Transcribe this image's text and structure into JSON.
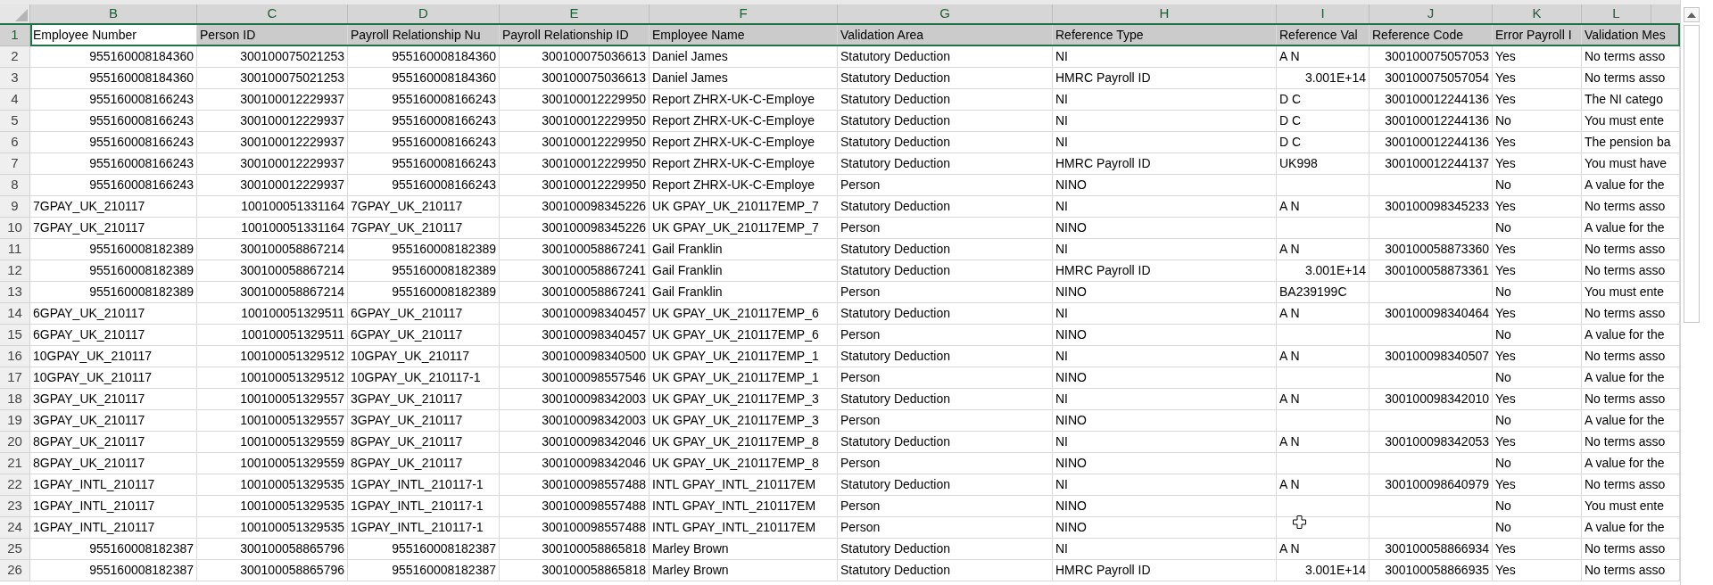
{
  "columns": [
    {
      "letter": "B"
    },
    {
      "letter": "C"
    },
    {
      "letter": "D"
    },
    {
      "letter": "E"
    },
    {
      "letter": "F"
    },
    {
      "letter": "G"
    },
    {
      "letter": "H"
    },
    {
      "letter": "I"
    },
    {
      "letter": "J"
    },
    {
      "letter": "K"
    },
    {
      "letter": "L"
    }
  ],
  "rows": [
    {
      "number": "1",
      "selected": true,
      "cells": [
        {
          "kind": "text",
          "text": "Employee Number",
          "active": true
        },
        {
          "kind": "text",
          "text": "Person ID",
          "active": false
        },
        {
          "kind": "text",
          "text": "Payroll Relationship Nu",
          "active": false
        },
        {
          "kind": "text",
          "text": "Payroll Relationship ID",
          "active": false
        },
        {
          "kind": "text",
          "text": "Employee Name",
          "active": false
        },
        {
          "kind": "text",
          "text": "Validation Area",
          "active": false
        },
        {
          "kind": "text",
          "text": "Reference Type",
          "active": false
        },
        {
          "kind": "text",
          "text": "Reference Val",
          "active": false
        },
        {
          "kind": "text",
          "text": "Reference Code",
          "active": false
        },
        {
          "kind": "text",
          "text": "Error Payroll I",
          "active": false
        },
        {
          "kind": "text",
          "text": "Validation Mes",
          "active": false
        }
      ]
    },
    {
      "number": "2",
      "selected": false,
      "cells": [
        {
          "kind": "number",
          "text": "955160008184360"
        },
        {
          "kind": "number",
          "text": "300100075021253"
        },
        {
          "kind": "number",
          "text": "955160008184360"
        },
        {
          "kind": "number",
          "text": "300100075036613"
        },
        {
          "kind": "text",
          "text": "Daniel James"
        },
        {
          "kind": "text",
          "text": "Statutory Deduction"
        },
        {
          "kind": "text",
          "text": "NI"
        },
        {
          "kind": "text",
          "text": "A N"
        },
        {
          "kind": "number",
          "text": "300100075057053"
        },
        {
          "kind": "text",
          "text": "Yes"
        },
        {
          "kind": "text",
          "text": "No terms asso"
        }
      ]
    },
    {
      "number": "3",
      "selected": false,
      "cells": [
        {
          "kind": "number",
          "text": "955160008184360"
        },
        {
          "kind": "number",
          "text": "300100075021253"
        },
        {
          "kind": "number",
          "text": "955160008184360"
        },
        {
          "kind": "number",
          "text": "300100075036613"
        },
        {
          "kind": "text",
          "text": "Daniel James"
        },
        {
          "kind": "text",
          "text": "Statutory Deduction"
        },
        {
          "kind": "text",
          "text": "HMRC Payroll ID"
        },
        {
          "kind": "number",
          "text": "3.001E+14"
        },
        {
          "kind": "number",
          "text": "300100075057054"
        },
        {
          "kind": "text",
          "text": "Yes"
        },
        {
          "kind": "text",
          "text": "No terms asso"
        }
      ]
    },
    {
      "number": "4",
      "selected": false,
      "cells": [
        {
          "kind": "number",
          "text": "955160008166243"
        },
        {
          "kind": "number",
          "text": "300100012229937"
        },
        {
          "kind": "number",
          "text": "955160008166243"
        },
        {
          "kind": "number",
          "text": "300100012229950"
        },
        {
          "kind": "text",
          "text": "Report ZHRX-UK-C-Employe"
        },
        {
          "kind": "text",
          "text": "Statutory Deduction"
        },
        {
          "kind": "text",
          "text": "NI"
        },
        {
          "kind": "text",
          "text": "D C"
        },
        {
          "kind": "number",
          "text": "300100012244136"
        },
        {
          "kind": "text",
          "text": "Yes"
        },
        {
          "kind": "text",
          "text": "The NI catego"
        }
      ]
    },
    {
      "number": "5",
      "selected": false,
      "cells": [
        {
          "kind": "number",
          "text": "955160008166243"
        },
        {
          "kind": "number",
          "text": "300100012229937"
        },
        {
          "kind": "number",
          "text": "955160008166243"
        },
        {
          "kind": "number",
          "text": "300100012229950"
        },
        {
          "kind": "text",
          "text": "Report ZHRX-UK-C-Employe"
        },
        {
          "kind": "text",
          "text": "Statutory Deduction"
        },
        {
          "kind": "text",
          "text": "NI"
        },
        {
          "kind": "text",
          "text": "D C"
        },
        {
          "kind": "number",
          "text": "300100012244136"
        },
        {
          "kind": "text",
          "text": "No"
        },
        {
          "kind": "text",
          "text": "You must ente"
        }
      ]
    },
    {
      "number": "6",
      "selected": false,
      "cells": [
        {
          "kind": "number",
          "text": "955160008166243"
        },
        {
          "kind": "number",
          "text": "300100012229937"
        },
        {
          "kind": "number",
          "text": "955160008166243"
        },
        {
          "kind": "number",
          "text": "300100012229950"
        },
        {
          "kind": "text",
          "text": "Report ZHRX-UK-C-Employe"
        },
        {
          "kind": "text",
          "text": "Statutory Deduction"
        },
        {
          "kind": "text",
          "text": "NI"
        },
        {
          "kind": "text",
          "text": "D C"
        },
        {
          "kind": "number",
          "text": "300100012244136"
        },
        {
          "kind": "text",
          "text": "Yes"
        },
        {
          "kind": "text",
          "text": "The pension ba"
        }
      ]
    },
    {
      "number": "7",
      "selected": false,
      "cells": [
        {
          "kind": "number",
          "text": "955160008166243"
        },
        {
          "kind": "number",
          "text": "300100012229937"
        },
        {
          "kind": "number",
          "text": "955160008166243"
        },
        {
          "kind": "number",
          "text": "300100012229950"
        },
        {
          "kind": "text",
          "text": "Report ZHRX-UK-C-Employe"
        },
        {
          "kind": "text",
          "text": "Statutory Deduction"
        },
        {
          "kind": "text",
          "text": "HMRC Payroll ID"
        },
        {
          "kind": "text",
          "text": "UK998"
        },
        {
          "kind": "number",
          "text": "300100012244137"
        },
        {
          "kind": "text",
          "text": "Yes"
        },
        {
          "kind": "text",
          "text": "You must have"
        }
      ]
    },
    {
      "number": "8",
      "selected": false,
      "cells": [
        {
          "kind": "number",
          "text": "955160008166243"
        },
        {
          "kind": "number",
          "text": "300100012229937"
        },
        {
          "kind": "number",
          "text": "955160008166243"
        },
        {
          "kind": "number",
          "text": "300100012229950"
        },
        {
          "kind": "text",
          "text": "Report ZHRX-UK-C-Employe"
        },
        {
          "kind": "text",
          "text": "Person"
        },
        {
          "kind": "text",
          "text": "NINO"
        },
        null,
        null,
        {
          "kind": "text",
          "text": "No"
        },
        {
          "kind": "text",
          "text": "A value for the"
        }
      ]
    },
    {
      "number": "9",
      "selected": false,
      "cells": [
        {
          "kind": "text",
          "text": "7GPAY_UK_210117"
        },
        {
          "kind": "number",
          "text": "100100051331164"
        },
        {
          "kind": "text",
          "text": "7GPAY_UK_210117"
        },
        {
          "kind": "number",
          "text": "300100098345226"
        },
        {
          "kind": "text",
          "text": "UK GPAY_UK_210117EMP_7"
        },
        {
          "kind": "text",
          "text": "Statutory Deduction"
        },
        {
          "kind": "text",
          "text": "NI"
        },
        {
          "kind": "text",
          "text": "A N"
        },
        {
          "kind": "number",
          "text": "300100098345233"
        },
        {
          "kind": "text",
          "text": "Yes"
        },
        {
          "kind": "text",
          "text": "No terms asso"
        }
      ]
    },
    {
      "number": "10",
      "selected": false,
      "cells": [
        {
          "kind": "text",
          "text": "7GPAY_UK_210117"
        },
        {
          "kind": "number",
          "text": "100100051331164"
        },
        {
          "kind": "text",
          "text": "7GPAY_UK_210117"
        },
        {
          "kind": "number",
          "text": "300100098345226"
        },
        {
          "kind": "text",
          "text": "UK GPAY_UK_210117EMP_7"
        },
        {
          "kind": "text",
          "text": "Person"
        },
        {
          "kind": "text",
          "text": "NINO"
        },
        null,
        null,
        {
          "kind": "text",
          "text": "No"
        },
        {
          "kind": "text",
          "text": "A value for the"
        }
      ]
    },
    {
      "number": "11",
      "selected": false,
      "cells": [
        {
          "kind": "number",
          "text": "955160008182389"
        },
        {
          "kind": "number",
          "text": "300100058867214"
        },
        {
          "kind": "number",
          "text": "955160008182389"
        },
        {
          "kind": "number",
          "text": "300100058867241"
        },
        {
          "kind": "text",
          "text": "Gail Franklin"
        },
        {
          "kind": "text",
          "text": "Statutory Deduction"
        },
        {
          "kind": "text",
          "text": "NI"
        },
        {
          "kind": "text",
          "text": "A N"
        },
        {
          "kind": "number",
          "text": "300100058873360"
        },
        {
          "kind": "text",
          "text": "Yes"
        },
        {
          "kind": "text",
          "text": "No terms asso"
        }
      ]
    },
    {
      "number": "12",
      "selected": false,
      "cells": [
        {
          "kind": "number",
          "text": "955160008182389"
        },
        {
          "kind": "number",
          "text": "300100058867214"
        },
        {
          "kind": "number",
          "text": "955160008182389"
        },
        {
          "kind": "number",
          "text": "300100058867241"
        },
        {
          "kind": "text",
          "text": "Gail Franklin"
        },
        {
          "kind": "text",
          "text": "Statutory Deduction"
        },
        {
          "kind": "text",
          "text": "HMRC Payroll ID"
        },
        {
          "kind": "number",
          "text": "3.001E+14"
        },
        {
          "kind": "number",
          "text": "300100058873361"
        },
        {
          "kind": "text",
          "text": "Yes"
        },
        {
          "kind": "text",
          "text": "No terms asso"
        }
      ]
    },
    {
      "number": "13",
      "selected": false,
      "cells": [
        {
          "kind": "number",
          "text": "955160008182389"
        },
        {
          "kind": "number",
          "text": "300100058867214"
        },
        {
          "kind": "number",
          "text": "955160008182389"
        },
        {
          "kind": "number",
          "text": "300100058867241"
        },
        {
          "kind": "text",
          "text": "Gail Franklin"
        },
        {
          "kind": "text",
          "text": "Person"
        },
        {
          "kind": "text",
          "text": "NINO"
        },
        {
          "kind": "text",
          "text": "BA239199C"
        },
        null,
        {
          "kind": "text",
          "text": "No"
        },
        {
          "kind": "text",
          "text": "You must ente"
        }
      ]
    },
    {
      "number": "14",
      "selected": false,
      "cells": [
        {
          "kind": "text",
          "text": "6GPAY_UK_210117"
        },
        {
          "kind": "number",
          "text": "100100051329511"
        },
        {
          "kind": "text",
          "text": "6GPAY_UK_210117"
        },
        {
          "kind": "number",
          "text": "300100098340457"
        },
        {
          "kind": "text",
          "text": "UK GPAY_UK_210117EMP_6"
        },
        {
          "kind": "text",
          "text": "Statutory Deduction"
        },
        {
          "kind": "text",
          "text": "NI"
        },
        {
          "kind": "text",
          "text": "A N"
        },
        {
          "kind": "number",
          "text": "300100098340464"
        },
        {
          "kind": "text",
          "text": "Yes"
        },
        {
          "kind": "text",
          "text": "No terms asso"
        }
      ]
    },
    {
      "number": "15",
      "selected": false,
      "cells": [
        {
          "kind": "text",
          "text": "6GPAY_UK_210117"
        },
        {
          "kind": "number",
          "text": "100100051329511"
        },
        {
          "kind": "text",
          "text": "6GPAY_UK_210117"
        },
        {
          "kind": "number",
          "text": "300100098340457"
        },
        {
          "kind": "text",
          "text": "UK GPAY_UK_210117EMP_6"
        },
        {
          "kind": "text",
          "text": "Person"
        },
        {
          "kind": "text",
          "text": "NINO"
        },
        null,
        null,
        {
          "kind": "text",
          "text": "No"
        },
        {
          "kind": "text",
          "text": "A value for the"
        }
      ]
    },
    {
      "number": "16",
      "selected": false,
      "cells": [
        {
          "kind": "text",
          "text": "10GPAY_UK_210117"
        },
        {
          "kind": "number",
          "text": "100100051329512"
        },
        {
          "kind": "text",
          "text": "10GPAY_UK_210117"
        },
        {
          "kind": "number",
          "text": "300100098340500"
        },
        {
          "kind": "text",
          "text": "UK GPAY_UK_210117EMP_1"
        },
        {
          "kind": "text",
          "text": "Statutory Deduction"
        },
        {
          "kind": "text",
          "text": "NI"
        },
        {
          "kind": "text",
          "text": "A N"
        },
        {
          "kind": "number",
          "text": "300100098340507"
        },
        {
          "kind": "text",
          "text": "Yes"
        },
        {
          "kind": "text",
          "text": "No terms asso"
        }
      ]
    },
    {
      "number": "17",
      "selected": false,
      "cells": [
        {
          "kind": "text",
          "text": "10GPAY_UK_210117"
        },
        {
          "kind": "number",
          "text": "100100051329512"
        },
        {
          "kind": "text",
          "text": "10GPAY_UK_210117-1"
        },
        {
          "kind": "number",
          "text": "300100098557546"
        },
        {
          "kind": "text",
          "text": "UK GPAY_UK_210117EMP_1"
        },
        {
          "kind": "text",
          "text": "Person"
        },
        {
          "kind": "text",
          "text": "NINO"
        },
        null,
        null,
        {
          "kind": "text",
          "text": "No"
        },
        {
          "kind": "text",
          "text": "A value for the"
        }
      ]
    },
    {
      "number": "18",
      "selected": false,
      "cells": [
        {
          "kind": "text",
          "text": "3GPAY_UK_210117"
        },
        {
          "kind": "number",
          "text": "100100051329557"
        },
        {
          "kind": "text",
          "text": "3GPAY_UK_210117"
        },
        {
          "kind": "number",
          "text": "300100098342003"
        },
        {
          "kind": "text",
          "text": "UK GPAY_UK_210117EMP_3"
        },
        {
          "kind": "text",
          "text": "Statutory Deduction"
        },
        {
          "kind": "text",
          "text": "NI"
        },
        {
          "kind": "text",
          "text": "A N"
        },
        {
          "kind": "number",
          "text": "300100098342010"
        },
        {
          "kind": "text",
          "text": "Yes"
        },
        {
          "kind": "text",
          "text": "No terms asso"
        }
      ]
    },
    {
      "number": "19",
      "selected": false,
      "cells": [
        {
          "kind": "text",
          "text": "3GPAY_UK_210117"
        },
        {
          "kind": "number",
          "text": "100100051329557"
        },
        {
          "kind": "text",
          "text": "3GPAY_UK_210117"
        },
        {
          "kind": "number",
          "text": "300100098342003"
        },
        {
          "kind": "text",
          "text": "UK GPAY_UK_210117EMP_3"
        },
        {
          "kind": "text",
          "text": "Person"
        },
        {
          "kind": "text",
          "text": "NINO"
        },
        null,
        null,
        {
          "kind": "text",
          "text": "No"
        },
        {
          "kind": "text",
          "text": "A value for the"
        }
      ]
    },
    {
      "number": "20",
      "selected": false,
      "cells": [
        {
          "kind": "text",
          "text": "8GPAY_UK_210117"
        },
        {
          "kind": "number",
          "text": "100100051329559"
        },
        {
          "kind": "text",
          "text": "8GPAY_UK_210117"
        },
        {
          "kind": "number",
          "text": "300100098342046"
        },
        {
          "kind": "text",
          "text": "UK GPAY_UK_210117EMP_8"
        },
        {
          "kind": "text",
          "text": "Statutory Deduction"
        },
        {
          "kind": "text",
          "text": "NI"
        },
        {
          "kind": "text",
          "text": "A N"
        },
        {
          "kind": "number",
          "text": "300100098342053"
        },
        {
          "kind": "text",
          "text": "Yes"
        },
        {
          "kind": "text",
          "text": "No terms asso"
        }
      ]
    },
    {
      "number": "21",
      "selected": false,
      "cells": [
        {
          "kind": "text",
          "text": "8GPAY_UK_210117"
        },
        {
          "kind": "number",
          "text": "100100051329559"
        },
        {
          "kind": "text",
          "text": "8GPAY_UK_210117"
        },
        {
          "kind": "number",
          "text": "300100098342046"
        },
        {
          "kind": "text",
          "text": "UK GPAY_UK_210117EMP_8"
        },
        {
          "kind": "text",
          "text": "Person"
        },
        {
          "kind": "text",
          "text": "NINO"
        },
        null,
        null,
        {
          "kind": "text",
          "text": "No"
        },
        {
          "kind": "text",
          "text": "A value for the"
        }
      ]
    },
    {
      "number": "22",
      "selected": false,
      "cells": [
        {
          "kind": "text",
          "text": "1GPAY_INTL_210117"
        },
        {
          "kind": "number",
          "text": "100100051329535"
        },
        {
          "kind": "text",
          "text": "1GPAY_INTL_210117-1"
        },
        {
          "kind": "number",
          "text": "300100098557488"
        },
        {
          "kind": "text",
          "text": "INTL GPAY_INTL_210117EM"
        },
        {
          "kind": "text",
          "text": "Statutory Deduction"
        },
        {
          "kind": "text",
          "text": "NI"
        },
        {
          "kind": "text",
          "text": "A N"
        },
        {
          "kind": "number",
          "text": "300100098640979"
        },
        {
          "kind": "text",
          "text": "Yes"
        },
        {
          "kind": "text",
          "text": "No terms asso"
        }
      ]
    },
    {
      "number": "23",
      "selected": false,
      "cells": [
        {
          "kind": "text",
          "text": "1GPAY_INTL_210117"
        },
        {
          "kind": "number",
          "text": "100100051329535"
        },
        {
          "kind": "text",
          "text": "1GPAY_INTL_210117-1"
        },
        {
          "kind": "number",
          "text": "300100098557488"
        },
        {
          "kind": "text",
          "text": "INTL GPAY_INTL_210117EM"
        },
        {
          "kind": "text",
          "text": "Person"
        },
        {
          "kind": "text",
          "text": "NINO"
        },
        null,
        null,
        {
          "kind": "text",
          "text": "No"
        },
        {
          "kind": "text",
          "text": "You must ente"
        }
      ]
    },
    {
      "number": "24",
      "selected": false,
      "cells": [
        {
          "kind": "text",
          "text": "1GPAY_INTL_210117"
        },
        {
          "kind": "number",
          "text": "100100051329535"
        },
        {
          "kind": "text",
          "text": "1GPAY_INTL_210117-1"
        },
        {
          "kind": "number",
          "text": "300100098557488"
        },
        {
          "kind": "text",
          "text": "INTL GPAY_INTL_210117EM"
        },
        {
          "kind": "text",
          "text": "Person"
        },
        {
          "kind": "text",
          "text": "NINO"
        },
        null,
        null,
        {
          "kind": "text",
          "text": "No"
        },
        {
          "kind": "text",
          "text": "A value for the"
        }
      ]
    },
    {
      "number": "25",
      "selected": false,
      "cells": [
        {
          "kind": "number",
          "text": "955160008182387"
        },
        {
          "kind": "number",
          "text": "300100058865796"
        },
        {
          "kind": "number",
          "text": "955160008182387"
        },
        {
          "kind": "number",
          "text": "300100058865818"
        },
        {
          "kind": "text",
          "text": "Marley Brown"
        },
        {
          "kind": "text",
          "text": "Statutory Deduction"
        },
        {
          "kind": "text",
          "text": "NI"
        },
        {
          "kind": "text",
          "text": "A N"
        },
        {
          "kind": "number",
          "text": "300100058866934"
        },
        {
          "kind": "text",
          "text": "Yes"
        },
        {
          "kind": "text",
          "text": "No terms asso"
        }
      ]
    },
    {
      "number": "26",
      "selected": false,
      "cells": [
        {
          "kind": "number",
          "text": "955160008182387"
        },
        {
          "kind": "number",
          "text": "300100058865796"
        },
        {
          "kind": "number",
          "text": "955160008182387"
        },
        {
          "kind": "number",
          "text": "300100058865818"
        },
        {
          "kind": "text",
          "text": "Marley Brown"
        },
        {
          "kind": "text",
          "text": "Statutory Deduction"
        },
        {
          "kind": "text",
          "text": "HMRC Payroll ID"
        },
        {
          "kind": "number",
          "text": "3.001E+14"
        },
        {
          "kind": "number",
          "text": "300100058866935"
        },
        {
          "kind": "text",
          "text": "Yes"
        },
        {
          "kind": "text",
          "text": "No terms asso"
        }
      ]
    }
  ]
}
